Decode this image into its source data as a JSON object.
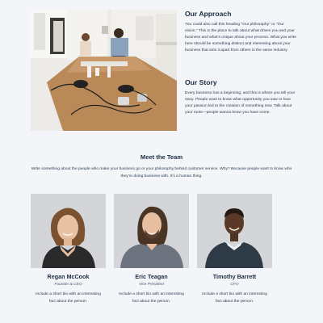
{
  "approach": {
    "heading": "Our Approach",
    "body": "You could also call this heading \"Our philosophy\" or \"Our vision.\" This is the place to talk about what drives you and your business and what's unique about your process. What you write here should be something distinct and interesting about your business that sets it apart from others in the same industry."
  },
  "story": {
    "heading": "Our Story",
    "body": "Every business has a beginning, and this is where you tell your story. People want to know what opportunity you saw or how your passion led to the creation of something new. Talk about your roots—people wanna know you have some."
  },
  "team": {
    "heading": "Meet the Team",
    "intro": "Write something about the people who make your business go or your philosophy behind customer service. Why? Because people want to know who they're doing business with. It's a human thing.",
    "members": [
      {
        "name": "Regan McCook",
        "role": "Founder & CEO",
        "bio": "Include a short bio with an interesting fact about the person."
      },
      {
        "name": "Eric Teagan",
        "role": "Vice President",
        "bio": "Include a short bio with an interesting fact about the person."
      },
      {
        "name": "Timothy Barrett",
        "role": "CFO",
        "bio": "Include a short bio with an interesting fact about the person."
      }
    ]
  }
}
